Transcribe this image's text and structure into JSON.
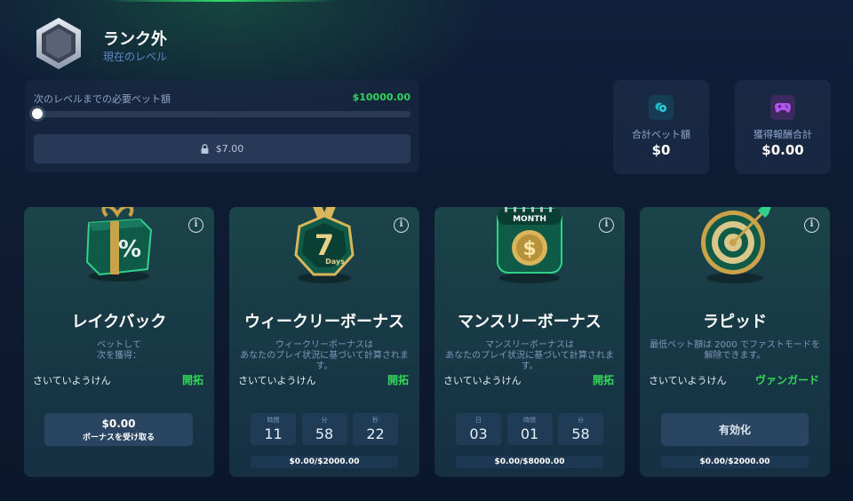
{
  "rank": {
    "title": "ランク外",
    "subtitle": "現在のレベル"
  },
  "progress": {
    "label": "次のレベルまでの必要ベット額",
    "target": "$10000.00",
    "fraction": 0.0,
    "locked_amount": "$7.00"
  },
  "stats": [
    {
      "label": "合計ベット額",
      "value": "$0",
      "icon": "coins-icon",
      "color": "#1fb7c7"
    },
    {
      "label": "獲得報酬合計",
      "value": "$0.00",
      "icon": "gamepad-icon",
      "color": "#a243d8"
    }
  ],
  "cards": {
    "rakeback": {
      "title": "レイクバック",
      "desc_line1": "ベットして",
      "desc_line2": "次を獲得：",
      "req_label": "さいていようけん",
      "req_value": "開拓",
      "claim_amount": "$0.00",
      "claim_label": "ボーナスを受け取る",
      "icon": "gift-percent-icon"
    },
    "weekly": {
      "title": "ウィークリーボーナス",
      "desc_line1": "ウィークリーボーナスは",
      "desc_line2": "あなたのプレイ状況に基づいて計算されま",
      "desc_line3": "す。",
      "req_label": "さいていようけん",
      "req_value": "開拓",
      "timer": [
        {
          "unit": "時間",
          "value": "11"
        },
        {
          "unit": "分",
          "value": "58"
        },
        {
          "unit": "秒",
          "value": "22"
        }
      ],
      "footer": "$0.00/$2000.00",
      "art_text": "7",
      "art_sub": "Days",
      "icon": "seven-days-icon"
    },
    "monthly": {
      "title": "マンスリーボーナス",
      "desc_line1": "マンスリーボーナスは",
      "desc_line2": "あなたのプレイ状況に基づいて計算されま",
      "desc_line3": "す。",
      "req_label": "さいていようけん",
      "req_value": "開拓",
      "timer": [
        {
          "unit": "日",
          "value": "03"
        },
        {
          "unit": "時間",
          "value": "01"
        },
        {
          "unit": "分",
          "value": "58"
        }
      ],
      "footer": "$0.00/$8000.00",
      "art_text": "MONTH",
      "icon": "calendar-dollar-icon"
    },
    "rapid": {
      "title": "ラピッド",
      "desc_line1": "最低ベット額は 2000 でファストモードを",
      "desc_line2": "解除できます。",
      "req_label": "さいていようけん",
      "req_value": "ヴァンガード",
      "button": "有効化",
      "footer": "$0.00/$2000.00",
      "icon": "dart-target-icon"
    }
  },
  "info_glyph": "i"
}
